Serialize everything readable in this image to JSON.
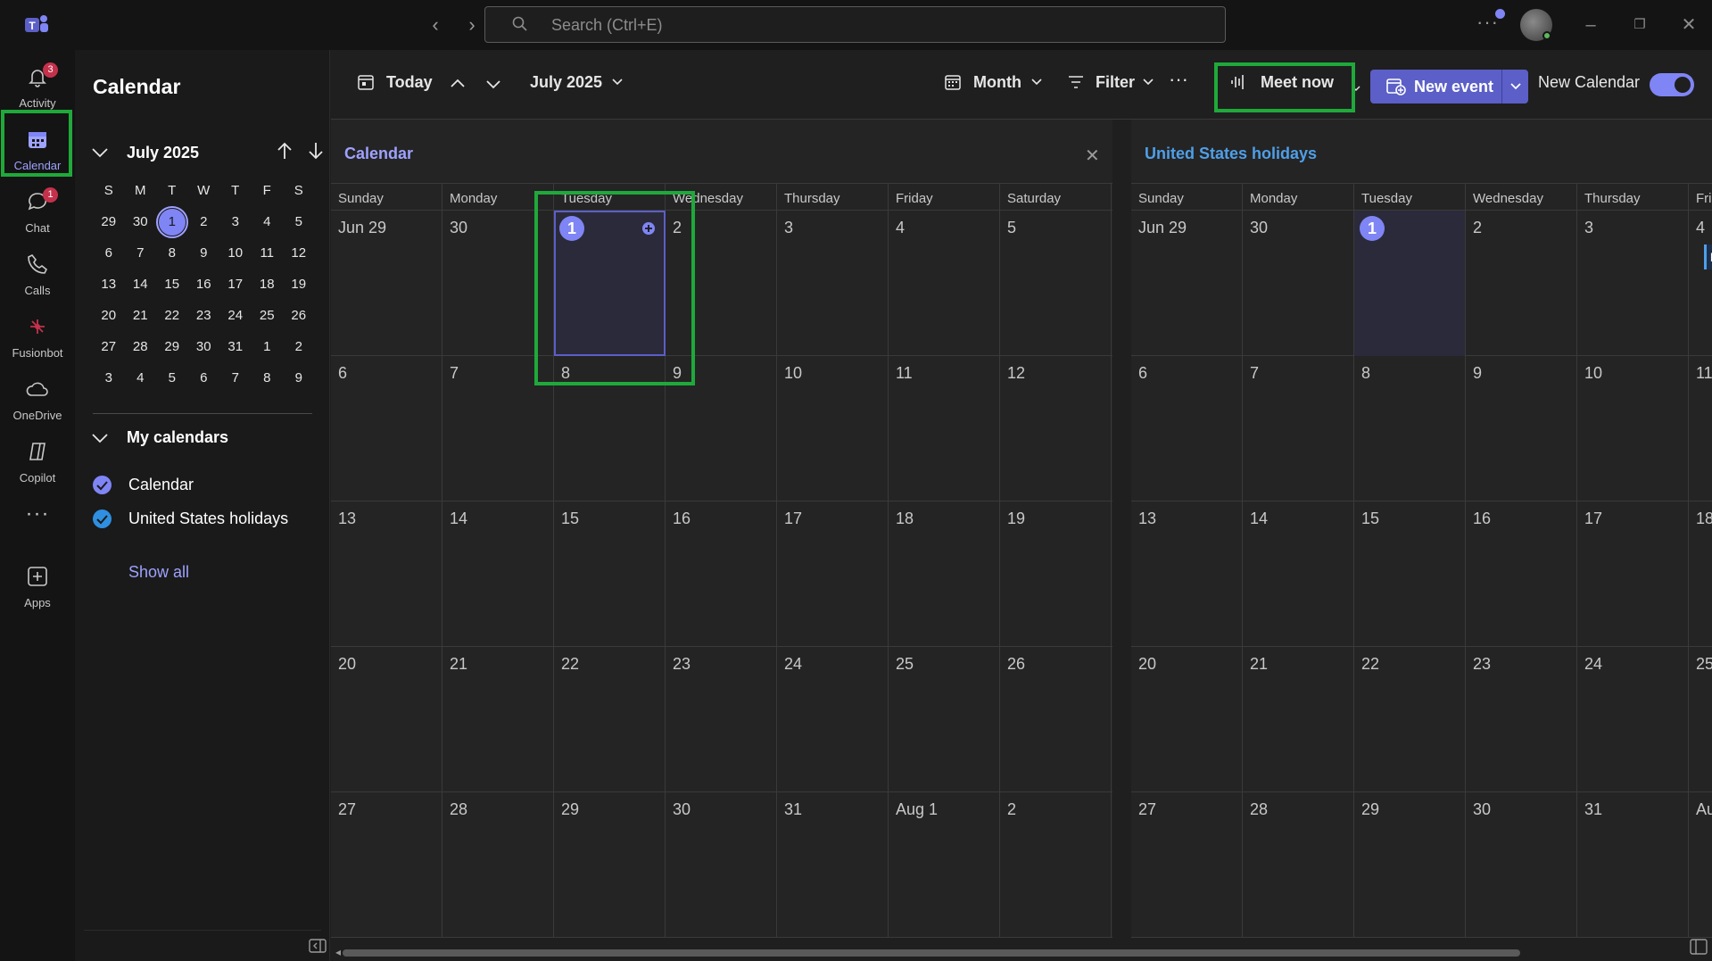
{
  "titlebar": {
    "search_placeholder": "Search (Ctrl+E)",
    "back_icon": "chevron-left",
    "forward_icon": "chevron-right",
    "more_icon": "ellipsis",
    "minimize_icon": "minimize",
    "restore_icon": "restore",
    "close_icon": "close"
  },
  "rail": {
    "items": [
      {
        "label": "Activity",
        "icon": "bell",
        "badge": "3"
      },
      {
        "label": "Calendar",
        "icon": "calendar",
        "badge": ""
      },
      {
        "label": "Chat",
        "icon": "chat",
        "badge": "1"
      },
      {
        "label": "Calls",
        "icon": "phone",
        "badge": ""
      },
      {
        "label": "Fusionbot",
        "icon": "bot",
        "badge": ""
      },
      {
        "label": "OneDrive",
        "icon": "cloud",
        "badge": ""
      },
      {
        "label": "Copilot",
        "icon": "copilot",
        "badge": ""
      },
      {
        "label": "",
        "icon": "more",
        "badge": ""
      },
      {
        "label": "Apps",
        "icon": "plus-square",
        "badge": ""
      }
    ]
  },
  "panel": {
    "title": "Calendar",
    "mini_month": "July 2025",
    "dow": [
      "S",
      "M",
      "T",
      "W",
      "T",
      "F",
      "S"
    ],
    "weeks": [
      [
        "29",
        "30",
        "1",
        "2",
        "3",
        "4",
        "5"
      ],
      [
        "6",
        "7",
        "8",
        "9",
        "10",
        "11",
        "12"
      ],
      [
        "13",
        "14",
        "15",
        "16",
        "17",
        "18",
        "19"
      ],
      [
        "20",
        "21",
        "22",
        "23",
        "24",
        "25",
        "26"
      ],
      [
        "27",
        "28",
        "29",
        "30",
        "31",
        "1",
        "2"
      ],
      [
        "3",
        "4",
        "5",
        "6",
        "7",
        "8",
        "9"
      ]
    ],
    "today": "1",
    "my_calendars_label": "My calendars",
    "calendars": [
      {
        "label": "Calendar",
        "color": "#7f85f5"
      },
      {
        "label": "United States holidays",
        "color": "#2f8fe0"
      }
    ],
    "show_all": "Show all"
  },
  "toolbar": {
    "today": "Today",
    "month_label": "July 2025",
    "view": "Month",
    "filter": "Filter",
    "more": "···",
    "meet_now": "Meet now",
    "new_event": "New event",
    "new_calendar": "New Calendar",
    "new_calendar_toggle_on": true
  },
  "calendar_a": {
    "title": "Calendar",
    "dow": [
      "Sunday",
      "Monday",
      "Tuesday",
      "Wednesday",
      "Thursday",
      "Friday",
      "Saturday"
    ],
    "weeks": [
      [
        "Jun 29",
        "30",
        "1",
        "2",
        "3",
        "4",
        "5"
      ],
      [
        "6",
        "7",
        "8",
        "9",
        "10",
        "11",
        "12"
      ],
      [
        "13",
        "14",
        "15",
        "16",
        "17",
        "18",
        "19"
      ],
      [
        "20",
        "21",
        "22",
        "23",
        "24",
        "25",
        "26"
      ],
      [
        "27",
        "28",
        "29",
        "30",
        "31",
        "Aug 1",
        "2"
      ]
    ]
  },
  "calendar_b": {
    "title": "United States holidays",
    "dow": [
      "Sunday",
      "Monday",
      "Tuesday",
      "Wednesday",
      "Thursday",
      "Fri"
    ],
    "weeks": [
      [
        "Jun 29",
        "30",
        "1",
        "2",
        "3",
        "4"
      ],
      [
        "6",
        "7",
        "8",
        "9",
        "10",
        "11"
      ],
      [
        "13",
        "14",
        "15",
        "16",
        "17",
        "18"
      ],
      [
        "20",
        "21",
        "22",
        "23",
        "24",
        "25"
      ],
      [
        "27",
        "28",
        "29",
        "30",
        "31",
        "Au"
      ]
    ],
    "holiday_chip": "In"
  },
  "colors": {
    "accent": "#7f85f5",
    "brand": "#5b5fc7",
    "highlight": "#1fa93a",
    "holiday": "#4f9fe8"
  }
}
